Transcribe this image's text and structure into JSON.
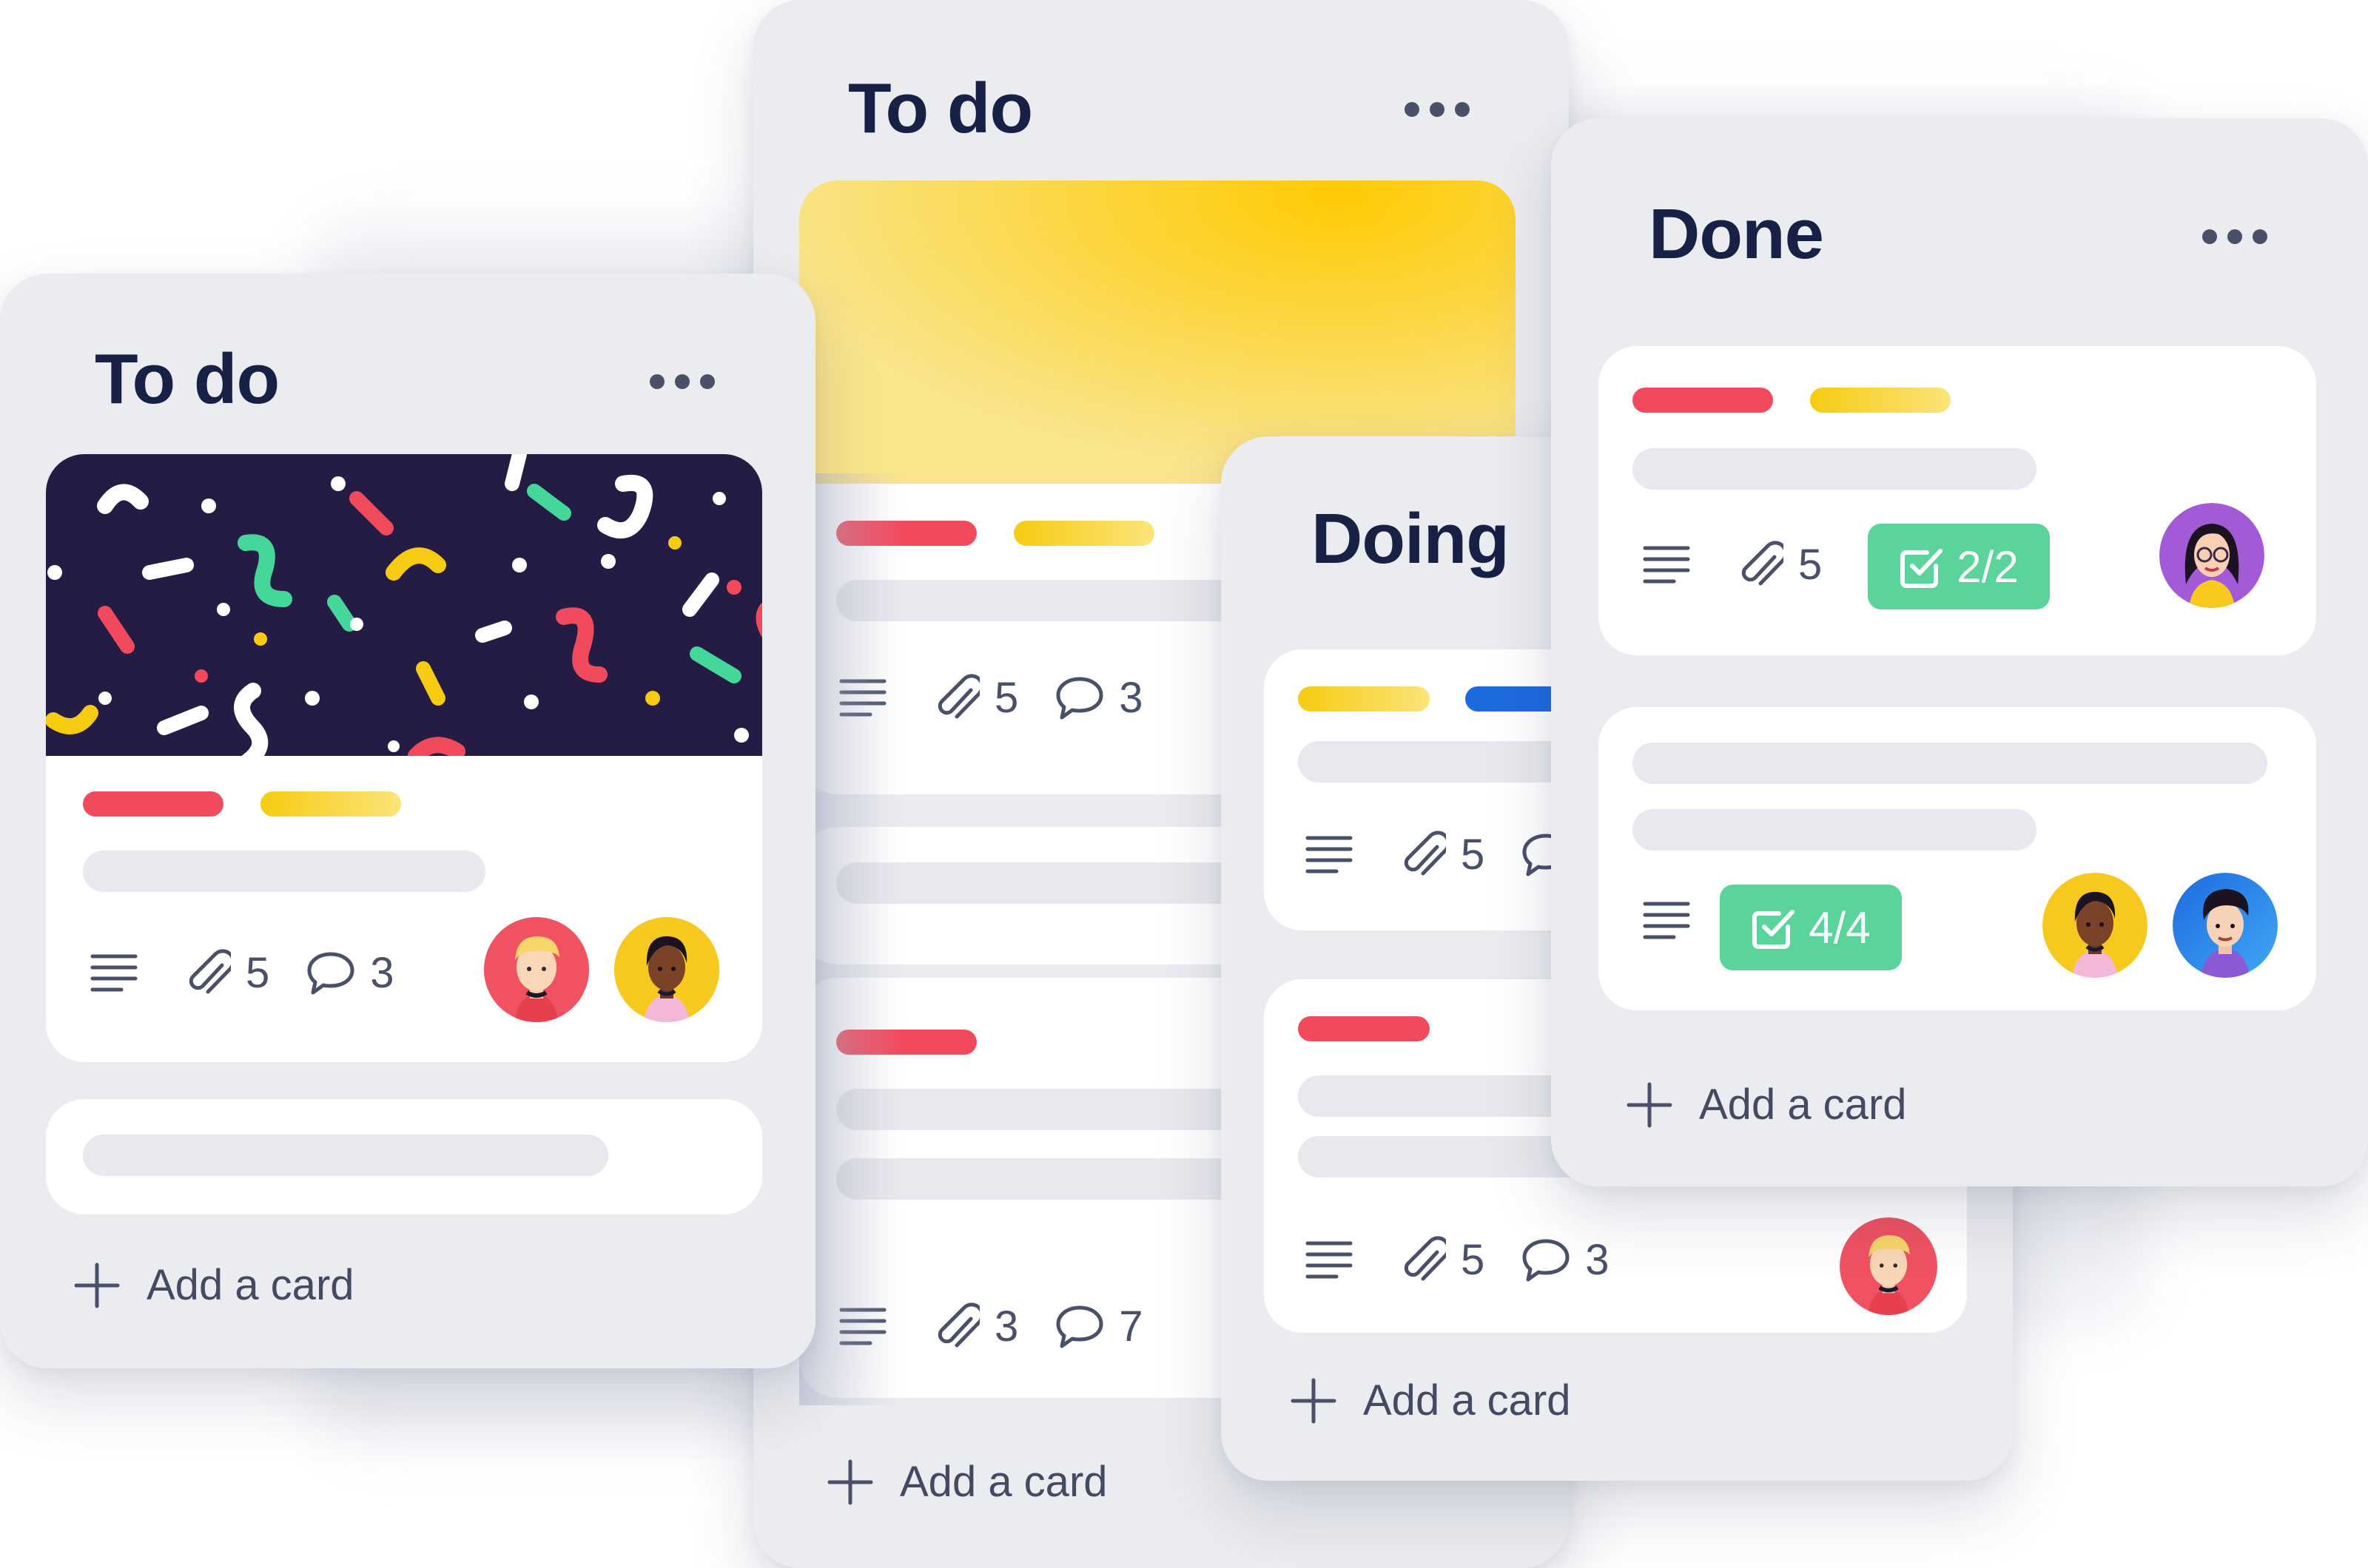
{
  "colors": {
    "label_red": "#f24a5d",
    "label_yellow": "#f6cb12",
    "label_blue": "#1e6be0",
    "checklist_green": "#5ad49a",
    "title_navy": "#172145",
    "list_bg": "#ebecf0",
    "cover_navy": "#241c45"
  },
  "lists": {
    "todo_left": {
      "title": "To do",
      "card1": {
        "attachments": "5",
        "comments": "3"
      },
      "add_label": "Add a card"
    },
    "todo_center": {
      "title": "To do",
      "card1": {
        "attachments": "5",
        "comments": "3"
      },
      "card3": {
        "attachments": "3",
        "comments": "7"
      },
      "add_label": "Add a card"
    },
    "doing": {
      "title": "Doing",
      "card1": {
        "attachments": "5"
      },
      "card2": {
        "attachments": "5",
        "comments": "3"
      },
      "add_label": "Add a card"
    },
    "done": {
      "title": "Done",
      "card1": {
        "attachments": "5",
        "checklist": "2/2"
      },
      "card2": {
        "checklist": "4/4"
      },
      "add_label": "Add a card"
    }
  },
  "icons": [
    "ellipsis-icon",
    "description-icon",
    "paperclip-icon",
    "comment-icon",
    "checklist-icon",
    "plus-icon"
  ]
}
